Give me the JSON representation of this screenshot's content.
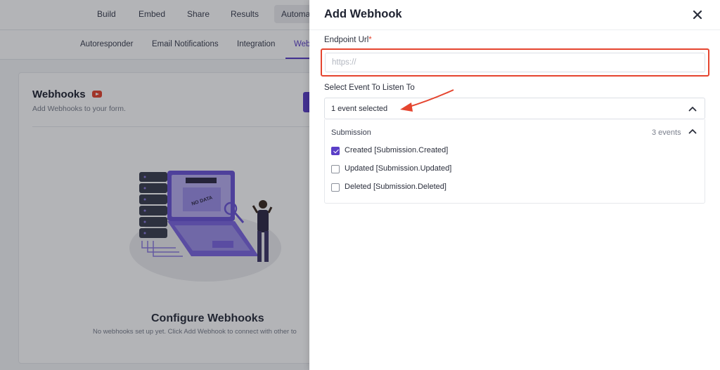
{
  "background": {
    "top_nav": [
      "Build",
      "Embed",
      "Share",
      "Results",
      "Automa"
    ],
    "sub_nav": [
      "Autoresponder",
      "Email Notifications",
      "Integration",
      "Web"
    ],
    "card": {
      "title": "Webhooks",
      "subtitle": "Add Webhooks to your form.",
      "illustration_text": "NO DATA",
      "empty_title": "Configure Webhooks",
      "empty_sub": "No webhooks set up yet. Click Add Webhook to connect with other to"
    }
  },
  "drawer": {
    "title": "Add Webhook",
    "endpoint": {
      "label": "Endpoint Url",
      "required_mark": "*",
      "placeholder": "https://",
      "value": ""
    },
    "event_select": {
      "label": "Select Event To Listen To",
      "value": "1 event selected",
      "group": {
        "name": "Submission",
        "count": "3 events",
        "options": [
          {
            "label": "Created [Submission.Created]",
            "checked": true
          },
          {
            "label": "Updated [Submission.Updated]",
            "checked": false
          },
          {
            "label": "Deleted [Submission.Deleted]",
            "checked": false
          }
        ]
      }
    }
  },
  "colors": {
    "accent": "#5b3fc7",
    "highlight": "#e5452f"
  }
}
